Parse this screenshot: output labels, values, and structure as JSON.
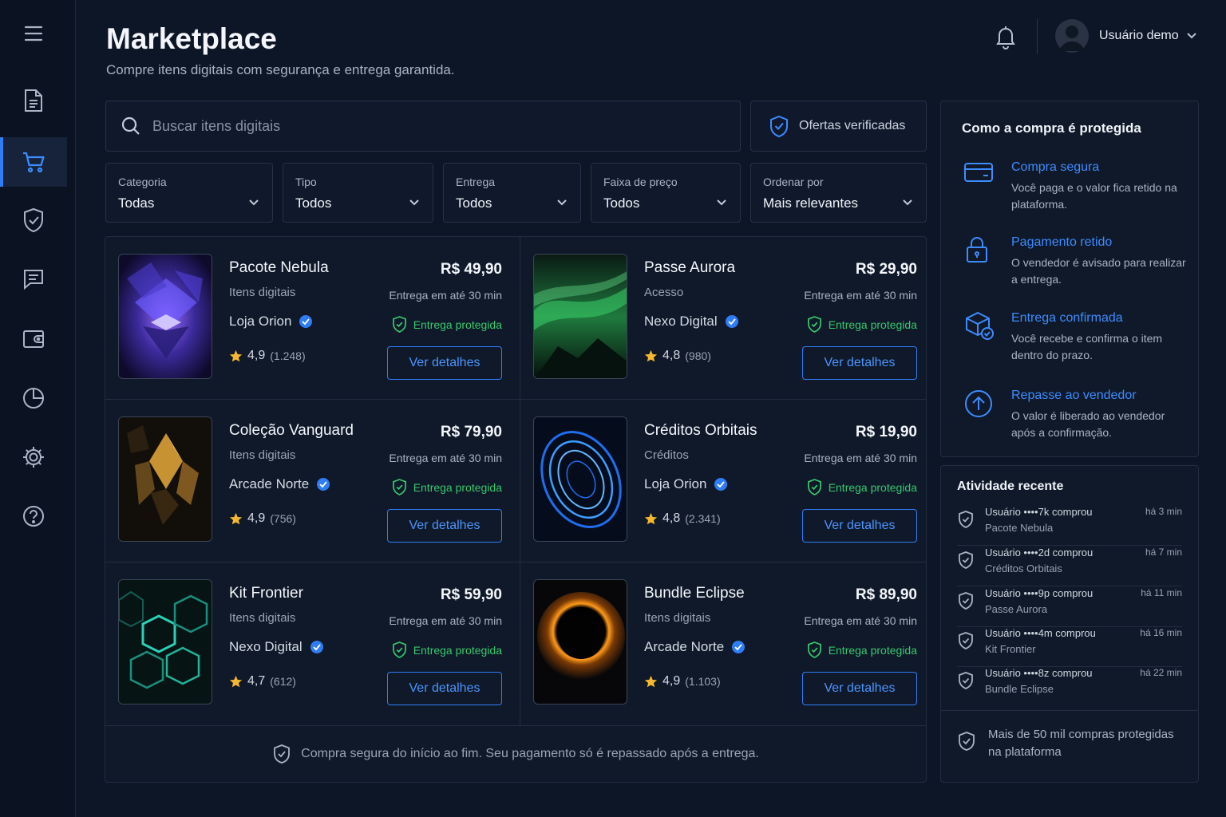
{
  "header": {
    "title": "Marketplace",
    "subtitle": "Compre itens digitais com segurança e entrega garantida.",
    "user_name": "Usuário demo"
  },
  "search": {
    "placeholder": "Buscar itens digitais",
    "value": ""
  },
  "verified_offers_label": "Ofertas verificadas",
  "filters": [
    {
      "label": "Categoria",
      "value": "Todas"
    },
    {
      "label": "Tipo",
      "value": "Todos"
    },
    {
      "label": "Entrega",
      "value": "Todos"
    },
    {
      "label": "Faixa de preço",
      "value": "Todos"
    },
    {
      "label": "Ordenar por",
      "value": "Mais relevantes"
    }
  ],
  "products": [
    {
      "name": "Pacote Nebula",
      "type": "Itens digitais",
      "seller": "Loja Orion",
      "rating": "4,9",
      "reviews": "(1.248)",
      "price": "R$ 49,90",
      "delivery": "Entrega em até 30 min",
      "protection": "Entrega protegida",
      "button": "Ver detalhes"
    },
    {
      "name": "Passe Aurora",
      "type": "Acesso",
      "seller": "Nexo Digital",
      "rating": "4,8",
      "reviews": "(980)",
      "price": "R$ 29,90",
      "delivery": "Entrega em até 30 min",
      "protection": "Entrega protegida",
      "button": "Ver detalhes"
    },
    {
      "name": "Coleção Vanguard",
      "type": "Itens digitais",
      "seller": "Arcade Norte",
      "rating": "4,9",
      "reviews": "(756)",
      "price": "R$ 79,90",
      "delivery": "Entrega em até 30 min",
      "protection": "Entrega protegida",
      "button": "Ver detalhes"
    },
    {
      "name": "Créditos Orbitais",
      "type": "Créditos",
      "seller": "Loja Orion",
      "rating": "4,8",
      "reviews": "(2.341)",
      "price": "R$ 19,90",
      "delivery": "Entrega em até 30 min",
      "protection": "Entrega protegida",
      "button": "Ver detalhes"
    },
    {
      "name": "Kit Frontier",
      "type": "Itens digitais",
      "seller": "Nexo Digital",
      "rating": "4,7",
      "reviews": "(612)",
      "price": "R$ 59,90",
      "delivery": "Entrega em até 30 min",
      "protection": "Entrega protegida",
      "button": "Ver detalhes"
    },
    {
      "name": "Bundle Eclipse",
      "type": "Itens digitais",
      "seller": "Arcade Norte",
      "rating": "4,9",
      "reviews": "(1.103)",
      "price": "R$ 89,90",
      "delivery": "Entrega em até 30 min",
      "protection": "Entrega protegida",
      "button": "Ver detalhes"
    }
  ],
  "footer_note": "Compra segura do início ao fim. Seu pagamento só é repassado após a entrega.",
  "protection_panel": {
    "title": "Como a compra é protegida",
    "steps": [
      {
        "title": "Compra segura",
        "desc": "Você paga e o valor fica retido na plataforma."
      },
      {
        "title": "Pagamento retido",
        "desc": "O vendedor é avisado para realizar a entrega."
      },
      {
        "title": "Entrega confirmada",
        "desc": "Você recebe e confirma o item dentro do prazo."
      },
      {
        "title": "Repasse ao vendedor",
        "desc": "O valor é liberado ao vendedor após a confirmação."
      }
    ]
  },
  "activity": {
    "title": "Atividade recente",
    "items": [
      {
        "line": "Usuário ••••7k comprou",
        "item": "Pacote Nebula",
        "time": "há 3 min"
      },
      {
        "line": "Usuário ••••2d comprou",
        "item": "Créditos Orbitais",
        "time": "há 7 min"
      },
      {
        "line": "Usuário ••••9p comprou",
        "item": "Passe Aurora",
        "time": "há 11 min"
      },
      {
        "line": "Usuário ••••4m comprou",
        "item": "Kit Frontier",
        "time": "há 16 min"
      },
      {
        "line": "Usuário ••••8z comprou",
        "item": "Bundle Eclipse",
        "time": "há 22 min"
      }
    ],
    "footer": "Mais de 50 mil compras protegidas na plataforma"
  },
  "sidebar_icons": [
    "menu-icon",
    "document-icon",
    "cart-icon",
    "shield-check-icon",
    "chat-icon",
    "wallet-icon",
    "pie-chart-icon",
    "gear-icon",
    "help-icon"
  ],
  "colors": {
    "accent": "#2f7df6",
    "success": "#37c86b",
    "star": "#f5b82e",
    "background": "#0d1626"
  }
}
